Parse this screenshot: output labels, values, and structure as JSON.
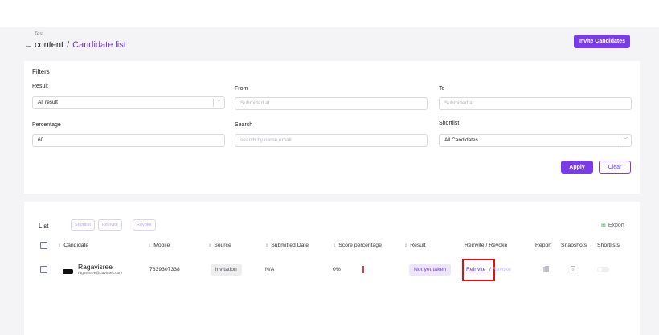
{
  "header": {
    "crumb_small": "Test",
    "back_glyph": "←",
    "crumb_parent": "content",
    "crumb_sep": "/",
    "crumb_current": "Candidate list",
    "invite_button": "Invite Candidates"
  },
  "filters": {
    "title": "Filters",
    "result_label": "Result",
    "result_value": "All result",
    "from_label": "From",
    "from_placeholder": "Submitted at",
    "to_label": "To",
    "to_placeholder": "Submitted at",
    "percentage_label": "Percentage",
    "percentage_value": "60",
    "search_label": "Search",
    "search_placeholder": "search by name,email",
    "shortlist_label": "Shortlist",
    "shortlist_value": "All Candidates",
    "apply": "Apply",
    "clear": "Clear"
  },
  "list": {
    "title": "List",
    "shortlist_btn": "Shortlist",
    "reinvite_btn": "Reinvite",
    "revoke_btn": "Revoke",
    "export": "Export",
    "columns": [
      "Candidate",
      "Mobile",
      "Source",
      "Submitted Date",
      "Score percentage",
      "Result",
      "Reinvite / Revoke",
      "Report",
      "Snapshots",
      "Shortlists"
    ],
    "rows": [
      {
        "name": "Ragavisree",
        "email": "ragavisree@cavintek.com",
        "mobile": "7639307338",
        "source": "invitation",
        "submitted": "N/A",
        "score": "0%",
        "result": "Not yet taken",
        "reinvite": "Reinvite",
        "slash": " / ",
        "revoke": "Revoke"
      }
    ]
  },
  "colors": {
    "accent": "#7a3ce8",
    "score_bar": "#e8364d",
    "highlight_box": "#e01010"
  }
}
